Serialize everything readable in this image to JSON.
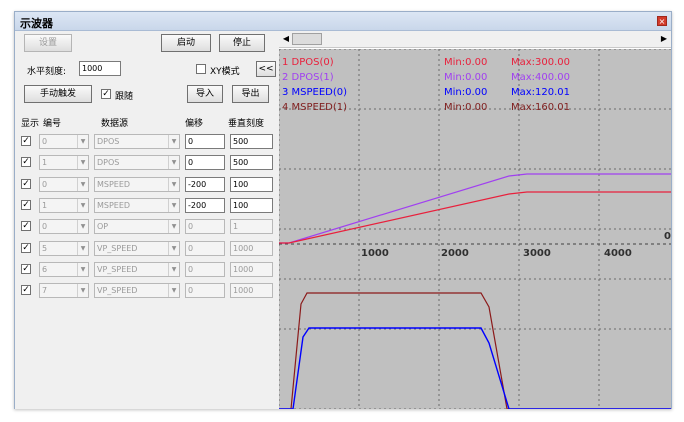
{
  "window": {
    "title": "示波器"
  },
  "controls": {
    "settings_label": "设置",
    "start_label": "启动",
    "stop_label": "停止",
    "h_scale_label": "水平刻度:",
    "h_scale_value": "1000",
    "xy_mode_label": "XY模式",
    "collapse_label": "<<",
    "manual_trigger_label": "手动触发",
    "follow_label": "跟随",
    "import_label": "导入",
    "export_label": "导出"
  },
  "table": {
    "headers": [
      "显示",
      "编号",
      "数据源",
      "偏移",
      "垂直刻度"
    ],
    "rows": [
      {
        "shown": true,
        "id": "0",
        "source": "DPOS",
        "offset": "0",
        "vscale": "500",
        "enabled": true
      },
      {
        "shown": true,
        "id": "1",
        "source": "DPOS",
        "offset": "0",
        "vscale": "500",
        "enabled": true
      },
      {
        "shown": true,
        "id": "0",
        "source": "MSPEED",
        "offset": "-200",
        "vscale": "100",
        "enabled": true
      },
      {
        "shown": true,
        "id": "1",
        "source": "MSPEED",
        "offset": "-200",
        "vscale": "100",
        "enabled": true
      },
      {
        "shown": true,
        "id": "0",
        "source": "OP",
        "offset": "0",
        "vscale": "1",
        "enabled": false
      },
      {
        "shown": true,
        "id": "5",
        "source": "VP_SPEED",
        "offset": "0",
        "vscale": "1000",
        "enabled": false
      },
      {
        "shown": true,
        "id": "6",
        "source": "VP_SPEED",
        "offset": "0",
        "vscale": "1000",
        "enabled": false
      },
      {
        "shown": true,
        "id": "7",
        "source": "VP_SPEED",
        "offset": "0",
        "vscale": "1000",
        "enabled": false
      }
    ]
  },
  "scope": {
    "legend": [
      {
        "name": "1 DPOS(0)",
        "min": "Min:0.00",
        "max": "Max:300.00",
        "color": "#e8203c"
      },
      {
        "name": "2 DPOS(1)",
        "min": "Min:0.00",
        "max": "Max:400.00",
        "color": "#a040f0"
      },
      {
        "name": "3 MSPEED(0)",
        "min": "Min:0.00",
        "max": "Max:120.01",
        "color": "#0000ff"
      },
      {
        "name": "4 MSPEED(1)",
        "min": "Min:0.00",
        "max": "Max:160.01",
        "color": "#802020"
      }
    ],
    "x_ticks": [
      "1000",
      "2000",
      "3000",
      "4000"
    ],
    "zero_label": "0"
  }
}
